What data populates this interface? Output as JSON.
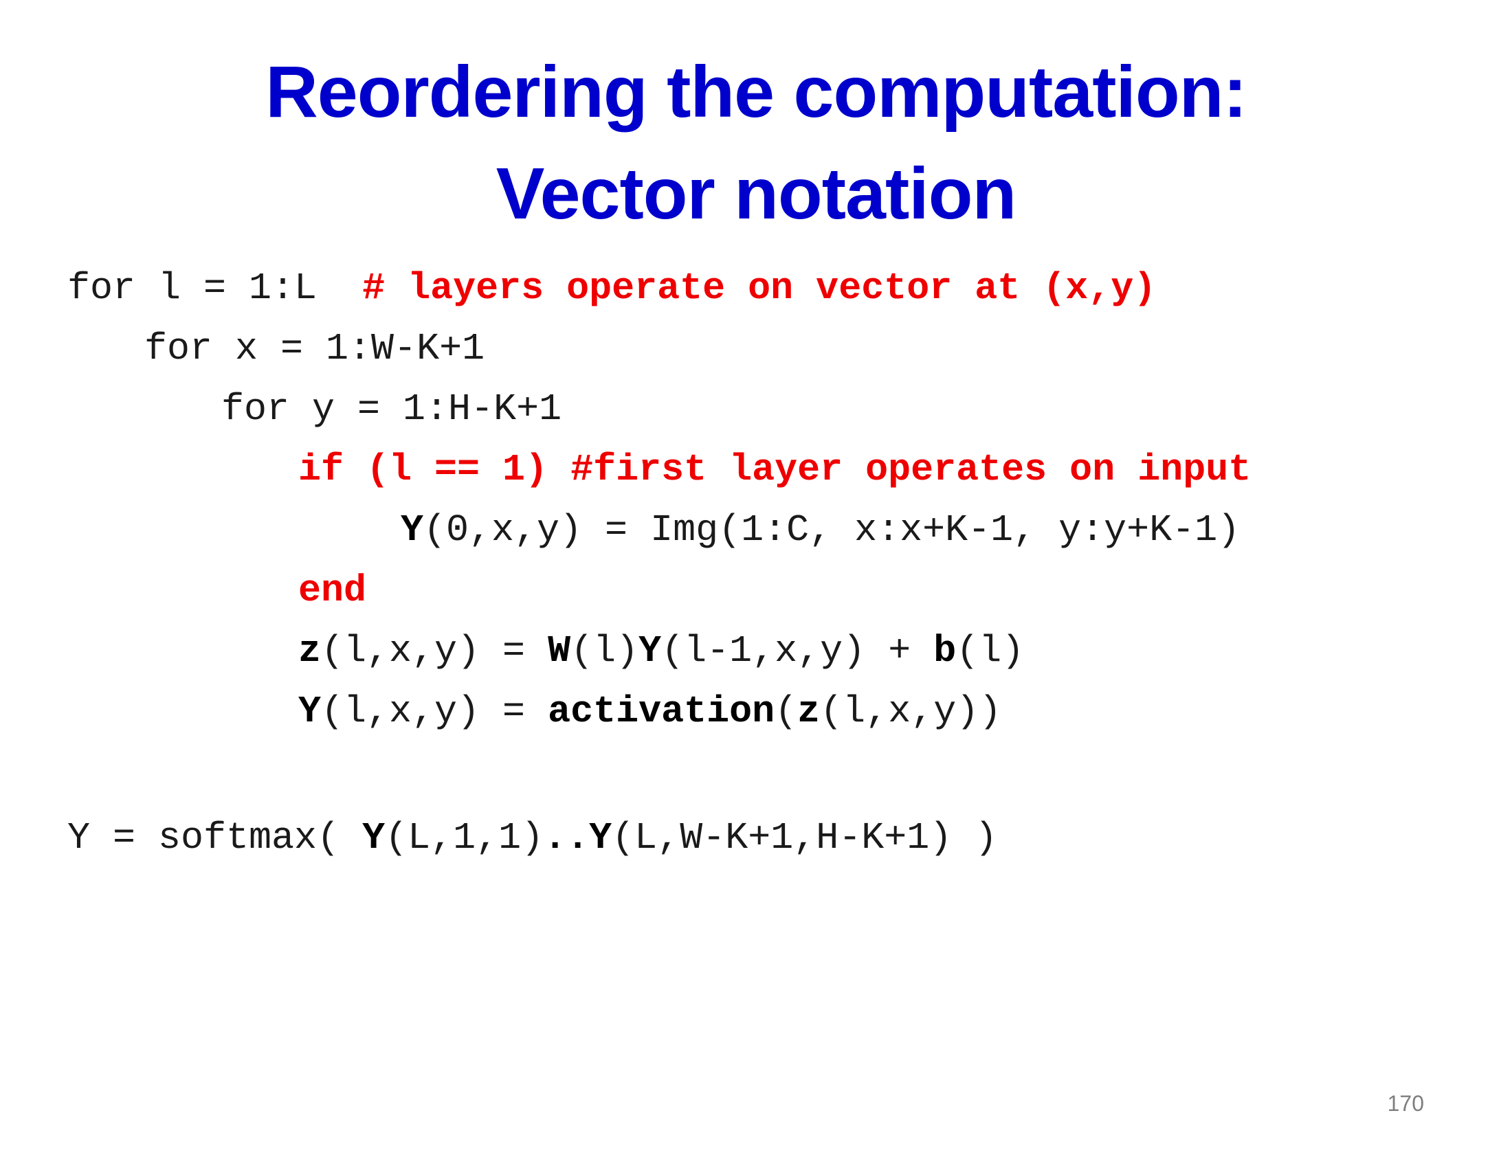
{
  "title": {
    "line1": "Reordering the computation:",
    "line2": "Vector notation"
  },
  "code": {
    "line1": {
      "stmt": "for l = 1:L  ",
      "comment": "# layers operate on vector at (x,y)"
    },
    "line2": "for x = 1:W-K+1",
    "line3": "for y = 1:H-K+1",
    "line4": "if (l == 1) #first layer operates on input",
    "line5": {
      "y": "Y",
      "rest": "(0,x,y) = Img(1:C, x:x+K-1, y:y+K-1)"
    },
    "line6": "end",
    "line7": {
      "z": "z",
      "p1": "(l,x,y) = ",
      "w": "W",
      "p2": "(l)",
      "y": "Y",
      "p3": "(l-1,x,y) + ",
      "b": "b",
      "p4": "(l)"
    },
    "line8": {
      "y": "Y",
      "p1": "(l,x,y) = ",
      "act": "activation",
      "p2": "(",
      "z": "z",
      "p3": "(l,x,y))"
    },
    "line9": {
      "p1": "Y = softmax( ",
      "y1": "Y",
      "p2": "(L,1,1)",
      "dots": "..",
      "y2": "Y",
      "p3": "(L,W-K+1,H-K+1) )"
    }
  },
  "page_number": "170",
  "colors": {
    "title": "#0000cc",
    "keyword_red": "#ee0000",
    "code_text": "#1a1a1a",
    "page_number": "#7f7f7f"
  }
}
